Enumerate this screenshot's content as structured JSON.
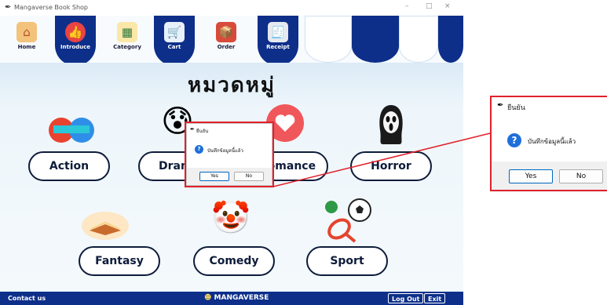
{
  "window": {
    "title": "Mangaverse Book Shop",
    "minimize": "–",
    "maximize": "□",
    "close": "×"
  },
  "nav": [
    {
      "id": "home",
      "label": "Home",
      "icon": "house-icon",
      "glyph": "⌂"
    },
    {
      "id": "introduce",
      "label": "Introduce",
      "icon": "thumbs-up-icon",
      "glyph": "👍"
    },
    {
      "id": "category",
      "label": "Category",
      "icon": "grid-icon",
      "glyph": "▦"
    },
    {
      "id": "cart",
      "label": "Cart",
      "icon": "cart-icon",
      "glyph": "🛒"
    },
    {
      "id": "order",
      "label": "Order",
      "icon": "order-icon",
      "glyph": "📦"
    },
    {
      "id": "receipt",
      "label": "Receipt",
      "icon": "receipt-icon",
      "glyph": "🧾"
    }
  ],
  "heading": "หมวดหมู่",
  "genres": {
    "action": "Action",
    "drama": "Drama",
    "romance": "Romance",
    "horror": "Horror",
    "fantasy": "Fantasy",
    "comedy": "Comedy",
    "sport": "Sport"
  },
  "footer": {
    "contact": "Contact us",
    "logo": "MANGAVERSE",
    "logout": "Log Out",
    "exit": "Exit"
  },
  "dialog": {
    "title": "ยืนยัน",
    "message": "บันทึกข้อมูลนี้แล้ว",
    "yes": "Yes",
    "no": "No",
    "icon": "question-icon"
  },
  "colors": {
    "navy": "#0d2f8a",
    "highlight": "#e0212b",
    "question": "#1e6fd9"
  }
}
